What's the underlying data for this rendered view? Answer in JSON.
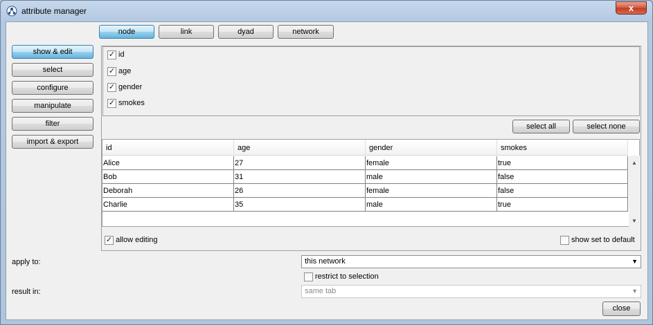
{
  "window": {
    "title": "attribute manager",
    "close_glyph": "x",
    "icon": "network-app-icon"
  },
  "tabs": [
    {
      "label": "node",
      "active": true
    },
    {
      "label": "link",
      "active": false
    },
    {
      "label": "dyad",
      "active": false
    },
    {
      "label": "network",
      "active": false
    }
  ],
  "sidebar": [
    {
      "label": "show & edit",
      "active": true
    },
    {
      "label": "select",
      "active": false
    },
    {
      "label": "configure",
      "active": false
    },
    {
      "label": "manipulate",
      "active": false
    },
    {
      "label": "filter",
      "active": false
    },
    {
      "label": "import & export",
      "active": false
    }
  ],
  "attributes": [
    {
      "label": "id",
      "checked": true
    },
    {
      "label": "age",
      "checked": true
    },
    {
      "label": "gender",
      "checked": true
    },
    {
      "label": "smokes",
      "checked": true
    }
  ],
  "buttons": {
    "select_all": "select all",
    "select_none": "select none",
    "close": "close"
  },
  "table": {
    "columns": [
      "id",
      "age",
      "gender",
      "smokes"
    ],
    "rows": [
      [
        "Alice",
        "27",
        "female",
        "true"
      ],
      [
        "Bob",
        "31",
        "male",
        "false"
      ],
      [
        "Deborah",
        "26",
        "female",
        "false"
      ],
      [
        "Charlie",
        "35",
        "male",
        "true"
      ]
    ]
  },
  "allow_editing": {
    "label": "allow editing",
    "checked": true
  },
  "show_set_to_default": {
    "label": "show set to default",
    "checked": false
  },
  "apply_to": {
    "label": "apply to:",
    "value": "this network"
  },
  "restrict_to_selection": {
    "label": "restrict to selection",
    "checked": false
  },
  "result_in": {
    "label": "result in:",
    "value": "same tab",
    "disabled": true
  },
  "check_glyph": "✓",
  "arrow_down": "▼",
  "arrow_up": "▲"
}
